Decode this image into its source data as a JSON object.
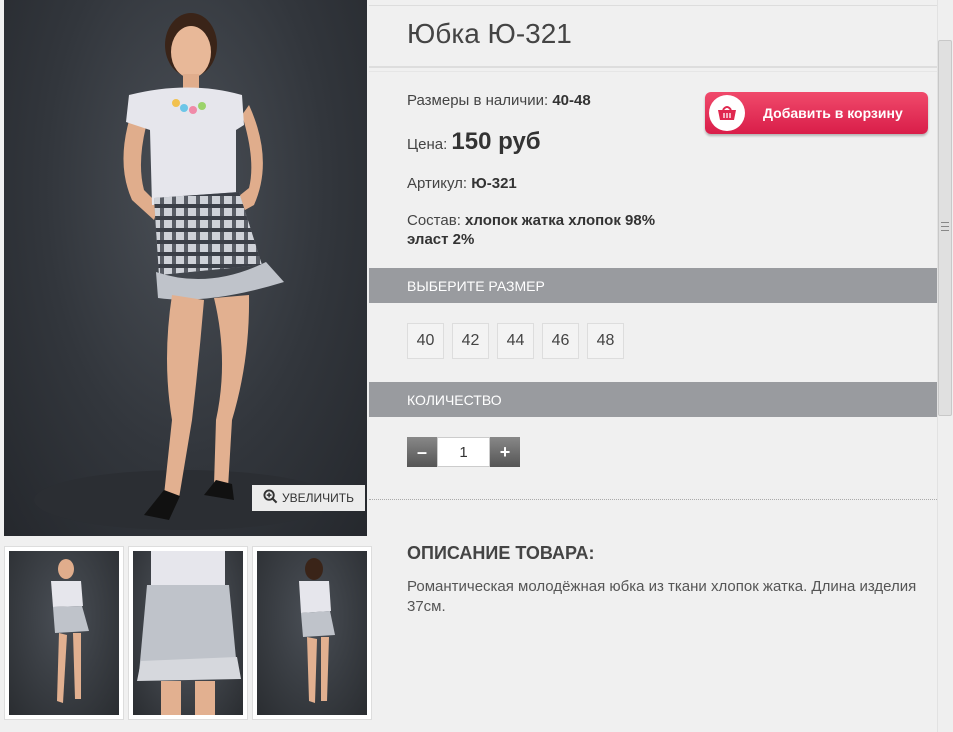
{
  "product": {
    "title": "Юбка Ю-321",
    "sizes_label": "Размеры в наличии: ",
    "sizes_value": "40-48",
    "price_label": "Цена: ",
    "price_value": "150 руб",
    "sku_label": "Артикул: ",
    "sku_value": "Ю-321",
    "composition_label": "Состав: ",
    "composition_value_1": "хлопок жатка хлопок 98%",
    "composition_value_2": "эласт 2%"
  },
  "cart": {
    "label": "Добавить в корзину",
    "icon": "basket-icon"
  },
  "gallery": {
    "zoom_label": "УВЕЛИЧИТЬ",
    "zoom_icon": "zoom-in-icon"
  },
  "size_section": {
    "title": "ВЫБЕРИТЕ РАЗМЕР",
    "options": [
      "40",
      "42",
      "44",
      "46",
      "48"
    ]
  },
  "quantity_section": {
    "title": "КОЛИЧЕСТВО",
    "value": "1",
    "minus": "–",
    "plus": "+"
  },
  "description": {
    "title": "ОПИСАНИЕ ТОВАРА:",
    "text": "Романтическая молодёжная юбка из ткани хлопок жатка. Длина изделия 37см."
  },
  "colors": {
    "accent": "#e0284f",
    "bar": "#999b9f"
  }
}
